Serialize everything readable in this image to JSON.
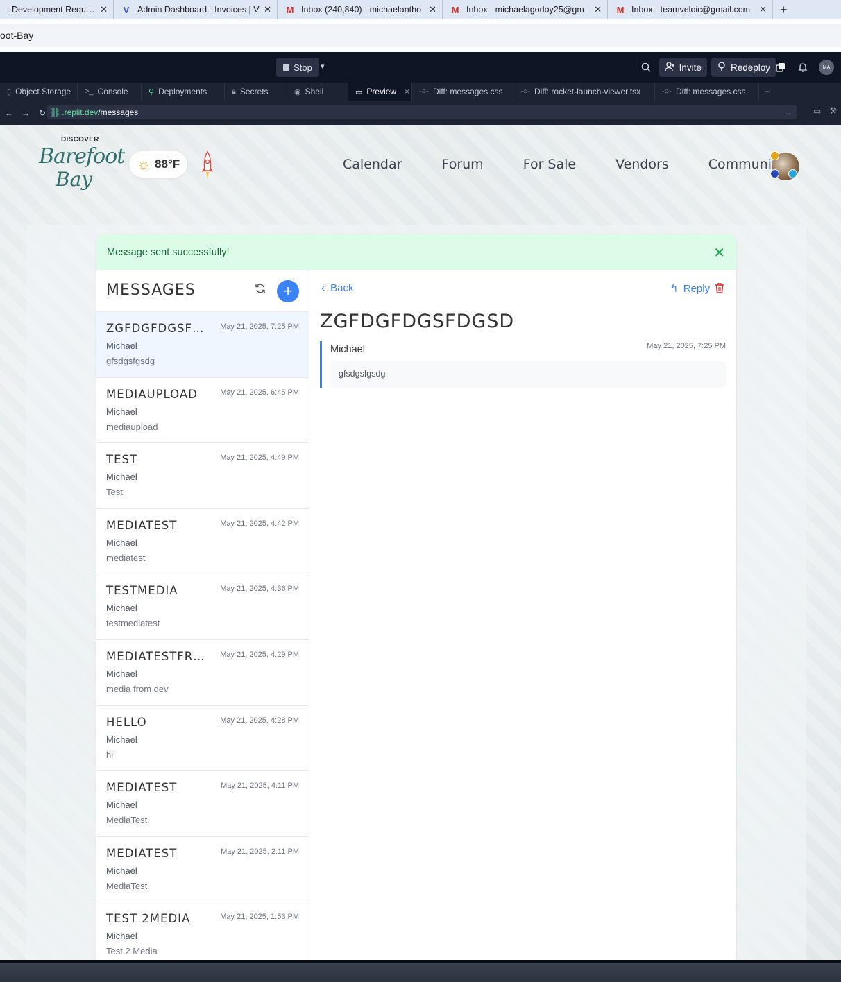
{
  "browser": {
    "tabs": [
      {
        "title": "t Development Requiren",
        "icon": "page-icon"
      },
      {
        "title": "Admin Dashboard - Invoices | V",
        "icon": "v-logo-icon"
      },
      {
        "title": "Inbox (240,840) - michaelantho",
        "icon": "gmail-icon"
      },
      {
        "title": "Inbox - michaelagodoy25@gm",
        "icon": "gmail-icon"
      },
      {
        "title": "Inbox - teamveloic@gmail.com",
        "icon": "gmail-icon"
      }
    ],
    "window_title": "oot-Bay"
  },
  "replit": {
    "stop_label": "Stop",
    "invite_label": "Invite",
    "redeploy_label": "Redeploy",
    "avatar_initials": "MA",
    "tabs": [
      {
        "label": "Object Storage",
        "icon": "storage-icon"
      },
      {
        "label": "Console",
        "icon": "terminal-icon"
      },
      {
        "label": "Deployments",
        "icon": "deploy-icon"
      },
      {
        "label": "Secrets",
        "icon": "lock-icon"
      },
      {
        "label": "Shell",
        "icon": "shell-icon"
      },
      {
        "label": "Preview",
        "icon": "monitor-icon",
        "active": true
      },
      {
        "label": "Diff: messages.css",
        "icon": "diff-icon"
      },
      {
        "label": "Diff: rocket-launch-viewer.tsx",
        "icon": "diff-icon"
      },
      {
        "label": "Diff: messages.css",
        "icon": "diff-icon"
      }
    ],
    "url_domain": ".replit.dev",
    "url_path": "/messages"
  },
  "site": {
    "logo_top": "DISCOVER",
    "logo_line1": "Barefoot",
    "logo_line2": "Bay",
    "temperature": "88°F",
    "nav": [
      "Calendar",
      "Forum",
      "For Sale",
      "Vendors",
      "Community"
    ]
  },
  "alert": "Message sent successfully!",
  "messages_title": "MESSAGES",
  "messages": [
    {
      "subject": "ZGFDGFDGSFDGSD",
      "date": "May 21, 2025, 7:25 PM",
      "from": "Michael",
      "preview": "gfsdgsfgsdg",
      "selected": true
    },
    {
      "subject": "MEDIAUPLOAD",
      "date": "May 21, 2025, 6:45 PM",
      "from": "Michael",
      "preview": "mediaupload"
    },
    {
      "subject": "TEST",
      "date": "May 21, 2025, 4:49 PM",
      "from": "Michael",
      "preview": "Test"
    },
    {
      "subject": "MEDIATEST",
      "date": "May 21, 2025, 4:42 PM",
      "from": "Michael",
      "preview": "mediatest"
    },
    {
      "subject": "TESTMEDIA",
      "date": "May 21, 2025, 4:36 PM",
      "from": "Michael",
      "preview": "testmediatest"
    },
    {
      "subject": "MEDIATESTFROMDEV",
      "date": "May 21, 2025, 4:29 PM",
      "from": "Michael",
      "preview": "media from dev"
    },
    {
      "subject": "HELLO",
      "date": "May 21, 2025, 4:28 PM",
      "from": "Michael",
      "preview": "hi"
    },
    {
      "subject": "MEDIATEST",
      "date": "May 21, 2025, 4:11 PM",
      "from": "Michael",
      "preview": "MediaTest"
    },
    {
      "subject": "MEDIATEST",
      "date": "May 21, 2025, 2:11 PM",
      "from": "Michael",
      "preview": "MediaTest"
    },
    {
      "subject": "TEST 2MEDIA",
      "date": "May 21, 2025, 1:53 PM",
      "from": "Michael",
      "preview": "Test 2 Media"
    }
  ],
  "detail": {
    "back_label": "Back",
    "reply_label": "Reply",
    "subject": "ZGFDGFDGSFDGSD",
    "from": "Michael",
    "date": "May 21, 2025, 7:25 PM",
    "body": "gfsdgsfgsdg"
  },
  "colors": {
    "accent": "#3b82f6",
    "success_bg": "#dcfce7",
    "success_text": "#166534",
    "danger": "#dc2626"
  }
}
